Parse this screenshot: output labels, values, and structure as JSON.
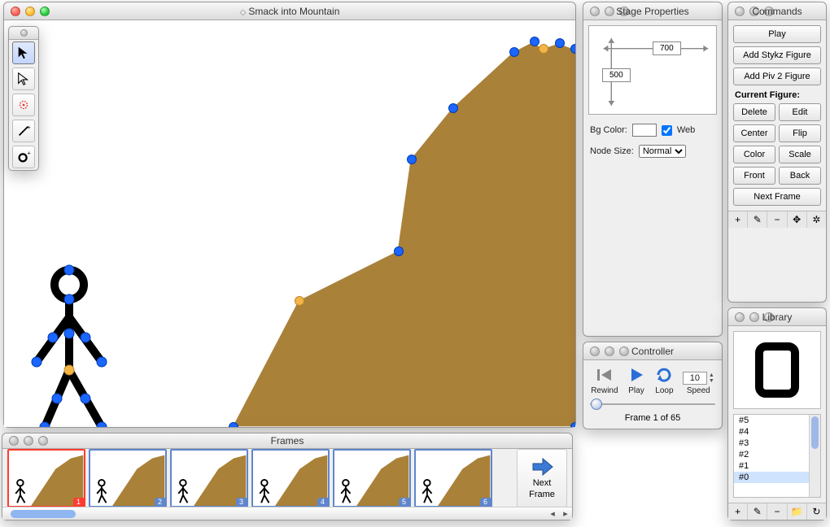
{
  "main": {
    "title": "Smack into Mountain"
  },
  "stageProps": {
    "title": "Stage Properties",
    "width": "700",
    "height": "500",
    "bgColorLabel": "Bg Color:",
    "webLabel": "Web",
    "nodeSizeLabel": "Node Size:",
    "nodeSize": "Normal"
  },
  "controller": {
    "title": "Controller",
    "rewind": "Rewind",
    "play": "Play",
    "loop": "Loop",
    "speedLabel": "Speed",
    "speed": "10",
    "frameText": "Frame 1 of 65"
  },
  "commands": {
    "title": "Commands",
    "play": "Play",
    "addStykz": "Add Stykz Figure",
    "addPiv": "Add Piv 2 Figure",
    "currentFigure": "Current Figure:",
    "delete": "Delete",
    "edit": "Edit",
    "center": "Center",
    "flip": "Flip",
    "color": "Color",
    "scale": "Scale",
    "front": "Front",
    "back": "Back",
    "nextFrame": "Next Frame"
  },
  "library": {
    "title": "Library",
    "items": [
      "#0",
      "#1",
      "#2",
      "#3",
      "#4",
      "#5"
    ],
    "selectedIndex": 0
  },
  "frames": {
    "title": "Frames",
    "nextFrameLabel1": "Next",
    "nextFrameLabel2": "Frame",
    "items": [
      "1",
      "2",
      "3",
      "4",
      "5",
      "6"
    ],
    "selectedIndex": 0
  },
  "tools": {
    "items": [
      "select-arrow",
      "direct-select",
      "target-node",
      "line-tool",
      "add-circle"
    ],
    "selectedIndex": 0
  },
  "iconStrip": {
    "plus": "+",
    "pencil": "✎",
    "minus": "−",
    "move": "✥",
    "gear": "✲",
    "folder": "📁",
    "refresh": "↻"
  }
}
